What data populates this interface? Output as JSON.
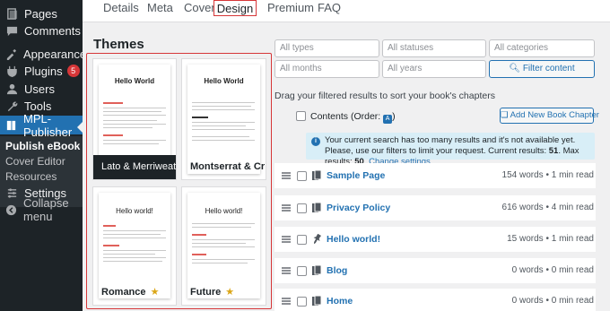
{
  "sidebar": {
    "items": [
      {
        "label": "Pages",
        "icon": "pages-icon"
      },
      {
        "label": "Comments",
        "icon": "comments-icon"
      },
      {
        "label": "Appearance",
        "icon": "appearance-icon"
      },
      {
        "label": "Plugins",
        "icon": "plugins-icon",
        "badge": "5"
      },
      {
        "label": "Users",
        "icon": "users-icon"
      },
      {
        "label": "Tools",
        "icon": "tools-icon"
      },
      {
        "label": "MPL-Publisher",
        "icon": "book-icon"
      },
      {
        "label": "Settings",
        "icon": "settings-icon"
      },
      {
        "label": "Collapse menu",
        "icon": "collapse-icon"
      }
    ],
    "submenu": [
      "Publish eBook",
      "Cover Editor",
      "Resources"
    ]
  },
  "tabs": [
    "Details",
    "Meta",
    "Cover",
    "Design",
    "Premium",
    "FAQ"
  ],
  "themes": {
    "title": "Themes",
    "cards": [
      {
        "label": "Lato & Merriweat…",
        "preview_title": "Hello World"
      },
      {
        "label": "Montserrat & Cr…",
        "preview_title": "Hello World"
      },
      {
        "label": "Romance",
        "preview_title": "Hello world!",
        "star": "★"
      },
      {
        "label": "Future",
        "preview_title": "Hello world!",
        "star": "★"
      }
    ]
  },
  "filters": {
    "types": "All types",
    "statuses": "All statuses",
    "categories": "All categories",
    "months": "All months",
    "years": "All years",
    "button": "Filter content"
  },
  "drag_note": "Drag your filtered results to sort your book's chapters",
  "contents": {
    "label": "Contents (Order:",
    "order_icon": "A",
    "close": ")",
    "add_button": "Add New Book Chapter"
  },
  "notice": {
    "text1": "Your current search has too many results and it's not available yet. Please, use our filters to limit your request. Current results: ",
    "current": "51",
    "text2": ". Max results: ",
    "max": "50",
    "text3": ". ",
    "link": "Change settings."
  },
  "chapters": [
    {
      "title": "Sample Page",
      "meta": "154 words • 1 min read",
      "icon": "page-icon"
    },
    {
      "title": "Privacy Policy",
      "meta": "616 words • 4 min read",
      "icon": "page-icon"
    },
    {
      "title": "Hello world!",
      "meta": "15 words • 1 min read",
      "icon": "pin-icon"
    },
    {
      "title": "Blog",
      "meta": "0 words • 0 min read",
      "icon": "page-icon"
    },
    {
      "title": "Home",
      "meta": "0 words • 0 min read",
      "icon": "page-icon"
    }
  ],
  "colors": {
    "accent": "#2271b1",
    "highlight": "#d63638",
    "sidebar": "#1d2327"
  }
}
